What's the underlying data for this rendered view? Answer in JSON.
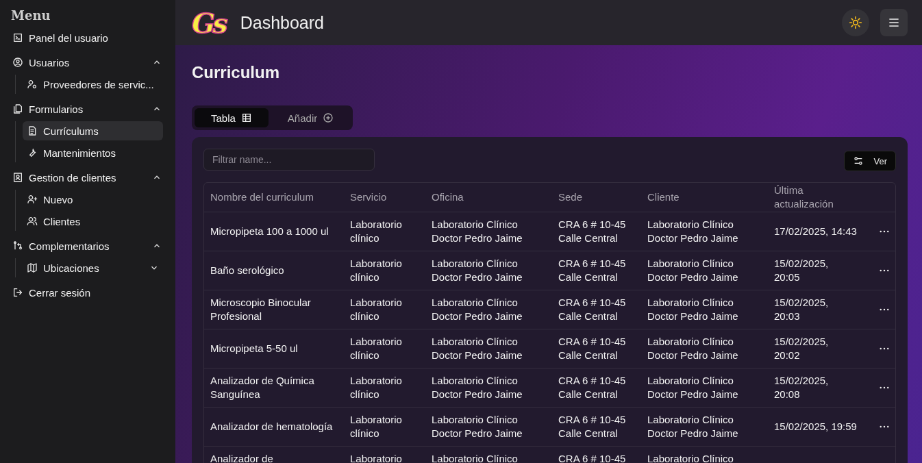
{
  "sidebar": {
    "title": "Menu",
    "items": [
      {
        "label": "Panel del usuario",
        "selected": false
      },
      {
        "label": "Usuarios",
        "selected": false,
        "expanded": true,
        "children": [
          {
            "label": "Proveedores de servic...",
            "selected": false
          }
        ]
      },
      {
        "label": "Formularios",
        "selected": false,
        "expanded": true,
        "children": [
          {
            "label": "Currículums",
            "selected": true
          },
          {
            "label": "Mantenimientos",
            "selected": false
          }
        ]
      },
      {
        "label": "Gestion de clientes",
        "selected": false,
        "expanded": true,
        "children": [
          {
            "label": "Nuevo",
            "selected": false
          },
          {
            "label": "Clientes",
            "selected": false
          }
        ]
      },
      {
        "label": "Complementarios",
        "selected": false,
        "expanded": true,
        "children": [
          {
            "label": "Ubicaciones",
            "selected": false,
            "expanded": false
          }
        ]
      },
      {
        "label": "Cerrar sesión",
        "selected": false
      }
    ]
  },
  "header": {
    "logo_text": "Gs",
    "title": "Dashboard"
  },
  "page": {
    "title": "Curriculum",
    "tabs": [
      {
        "label": "Tabla",
        "selected": true
      },
      {
        "label": "Añadir",
        "selected": false
      }
    ]
  },
  "table": {
    "filter_placeholder": "Filtrar name...",
    "view_button": "Ver",
    "columns": [
      "Nombre del curriculum",
      "Servicio",
      "Oficina",
      "Sede",
      "Cliente",
      "Última\nactualización"
    ],
    "rows": [
      {
        "cells": [
          "Micropipeta 100 a 1000 ul",
          "Laboratorio\nclínico",
          "Laboratorio Clínico\nDoctor Pedro Jaime",
          "CRA 6 # 10-45\nCalle Central",
          "Laboratorio Clínico\nDoctor Pedro Jaime",
          "17/02/2025, 14:43"
        ]
      },
      {
        "cells": [
          "Baño serológico",
          "Laboratorio\nclínico",
          "Laboratorio Clínico\nDoctor Pedro Jaime",
          "CRA 6 # 10-45\nCalle Central",
          "Laboratorio Clínico\nDoctor Pedro Jaime",
          "15/02/2025,\n20:05"
        ]
      },
      {
        "cells": [
          "Microscopio Binocular\nProfesional",
          "Laboratorio\nclínico",
          "Laboratorio Clínico\nDoctor Pedro Jaime",
          "CRA 6 # 10-45\nCalle Central",
          "Laboratorio Clínico\nDoctor Pedro Jaime",
          "15/02/2025,\n20:03"
        ]
      },
      {
        "cells": [
          "Micropipeta 5-50 ul",
          "Laboratorio\nclínico",
          "Laboratorio Clínico\nDoctor Pedro Jaime",
          "CRA 6 # 10-45\nCalle Central",
          "Laboratorio Clínico\nDoctor Pedro Jaime",
          "15/02/2025,\n20:02"
        ]
      },
      {
        "cells": [
          "Analizador de Química\nSanguínea",
          "Laboratorio\nclínico",
          "Laboratorio Clínico\nDoctor Pedro Jaime",
          "CRA 6 # 10-45\nCalle Central",
          "Laboratorio Clínico\nDoctor Pedro Jaime",
          "15/02/2025,\n20:08"
        ]
      },
      {
        "cells": [
          "Analizador de hematología",
          "Laboratorio\nclínico",
          "Laboratorio Clínico\nDoctor Pedro Jaime",
          "CRA 6 # 10-45\nCalle Central",
          "Laboratorio Clínico\nDoctor Pedro Jaime",
          "15/02/2025, 19:59"
        ]
      },
      {
        "cells": [
          "Analizador de",
          "Laboratorio",
          "Laboratorio Clínico",
          "CRA 6 # 10-45",
          "Laboratorio Clínico"
        ]
      }
    ]
  }
}
